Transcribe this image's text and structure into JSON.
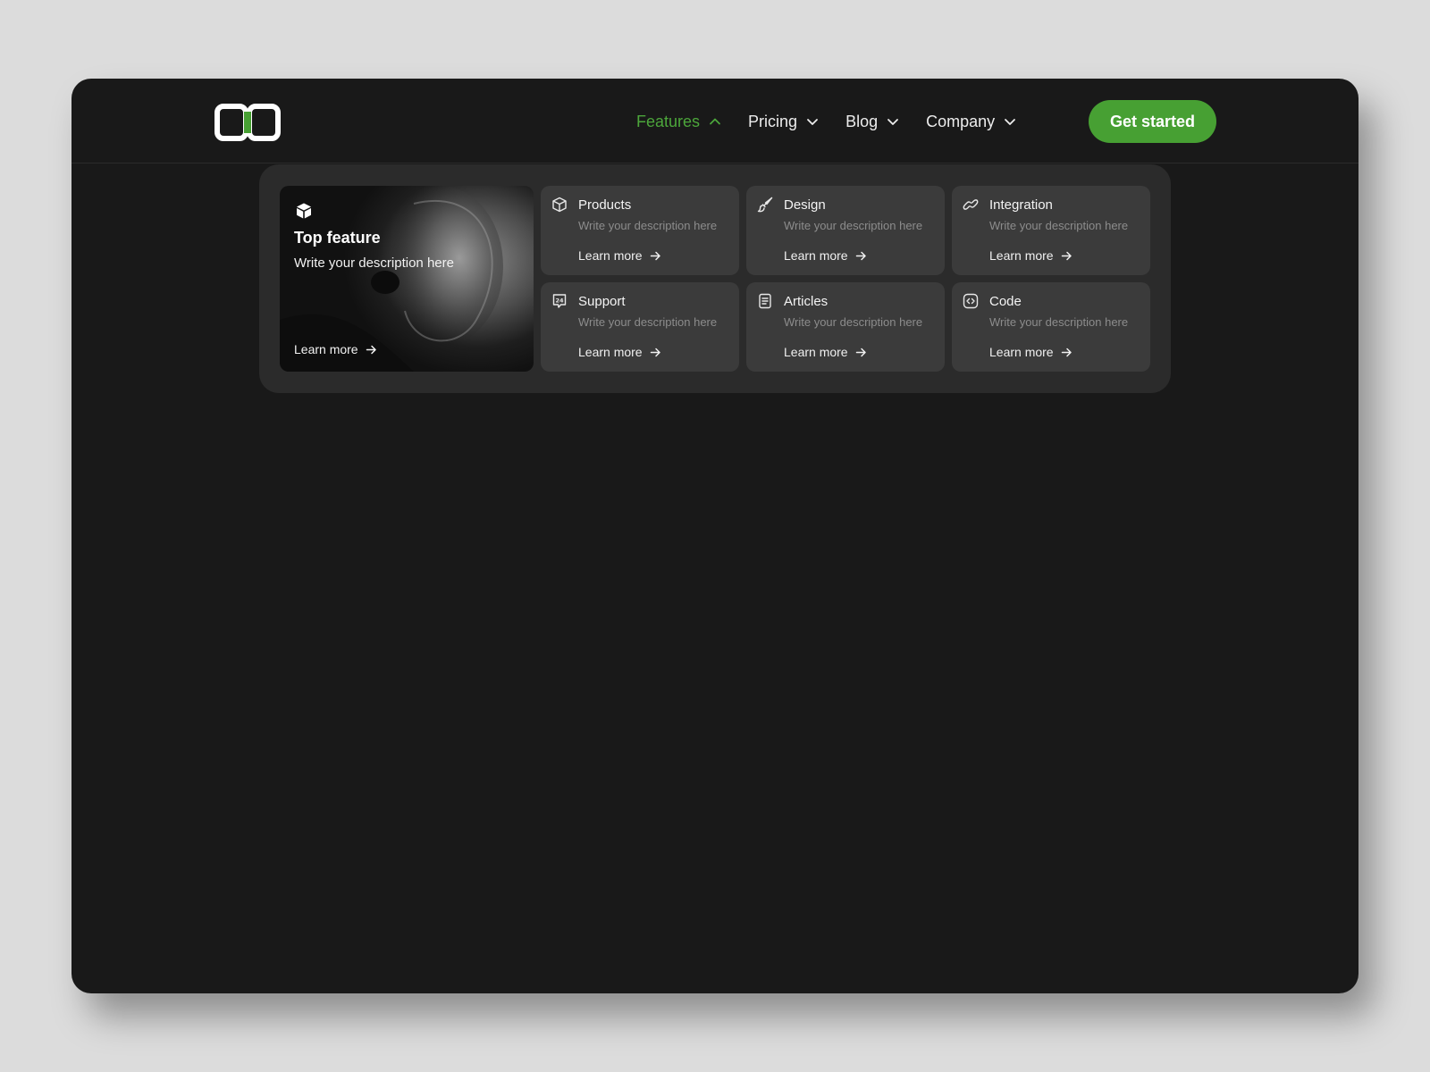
{
  "nav": {
    "logo_name": "logo-mark",
    "items": [
      {
        "label": "Features",
        "active": true,
        "icon": "chevron-up-icon"
      },
      {
        "label": "Pricing",
        "active": false,
        "icon": "chevron-down-icon"
      },
      {
        "label": "Blog",
        "active": false,
        "icon": "chevron-down-icon"
      },
      {
        "label": "Company",
        "active": false,
        "icon": "chevron-down-icon"
      }
    ],
    "cta_label": "Get started"
  },
  "dropdown": {
    "top_feature": {
      "icon": "cube-icon",
      "title": "Top feature",
      "description": "Write your description here",
      "link": "Learn more"
    },
    "cards": [
      {
        "icon": "box-icon",
        "title": "Products",
        "description": "Write your description here",
        "link": "Learn more"
      },
      {
        "icon": "brush-icon",
        "title": "Design",
        "description": "Write your description here",
        "link": "Learn more"
      },
      {
        "icon": "link-icon",
        "title": "Integration",
        "description": "Write your description here",
        "link": "Learn more"
      },
      {
        "icon": "support-24-icon",
        "title": "Support",
        "description": "Write your description here",
        "link": "Learn more"
      },
      {
        "icon": "document-icon",
        "title": "Articles",
        "description": "Write your description here",
        "link": "Learn more"
      },
      {
        "icon": "code-icon",
        "title": "Code",
        "description": "Write your description here",
        "link": "Learn more"
      }
    ]
  },
  "colors": {
    "accent": "#47a033",
    "active_nav": "#4ca63b",
    "window_bg": "#191919",
    "dropdown_bg": "#2b2b2b",
    "card_bg": "#3b3b3b",
    "page_bg": "#dcdcdc"
  }
}
